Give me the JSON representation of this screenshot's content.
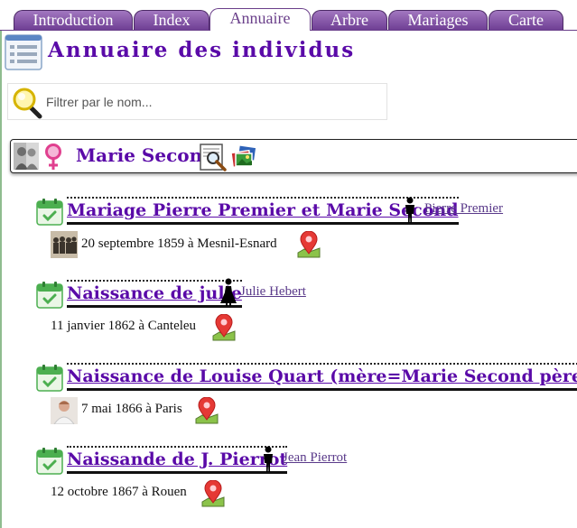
{
  "tabs": [
    {
      "label": "Introduction",
      "active": false
    },
    {
      "label": "Index",
      "active": false
    },
    {
      "label": "Annuaire",
      "active": true
    },
    {
      "label": "Arbre",
      "active": false
    },
    {
      "label": "Mariages",
      "active": false
    },
    {
      "label": "Carte",
      "active": false
    }
  ],
  "header": {
    "title": "Annuaire des individus"
  },
  "filter": {
    "placeholder": "Filtrer par le nom..."
  },
  "person": {
    "name": "Marie Second"
  },
  "events": [
    {
      "title": "Mariage Pierre Premier et Marie Second",
      "related": "Pierre Premier",
      "related_gender": "male",
      "detail": "20 septembre 1859 à Mesnil-Esnard",
      "thumb": "group-photo"
    },
    {
      "title": "Naissance de julie",
      "related": "Julie Hebert",
      "related_gender": "female",
      "detail": "11 janvier 1862 à Canteleu",
      "thumb": ""
    },
    {
      "title": "Naissance de Louise Quart (mère=Marie Second père=Pierre Premier)",
      "related": "",
      "related_gender": "",
      "detail": "7 mai 1866 à Paris",
      "thumb": "portrait-photo"
    },
    {
      "title": "Naissande de J. Pierrot",
      "related": "Jean Pierrot",
      "related_gender": "male",
      "detail": "12 octobre 1867 à Rouen",
      "thumb": ""
    }
  ],
  "colors": {
    "accent": "#5a0aa8",
    "tab_bg": "#8a5fae",
    "link": "#5a3a8a",
    "calendar": "#4caf50",
    "pin": "#e53935"
  }
}
